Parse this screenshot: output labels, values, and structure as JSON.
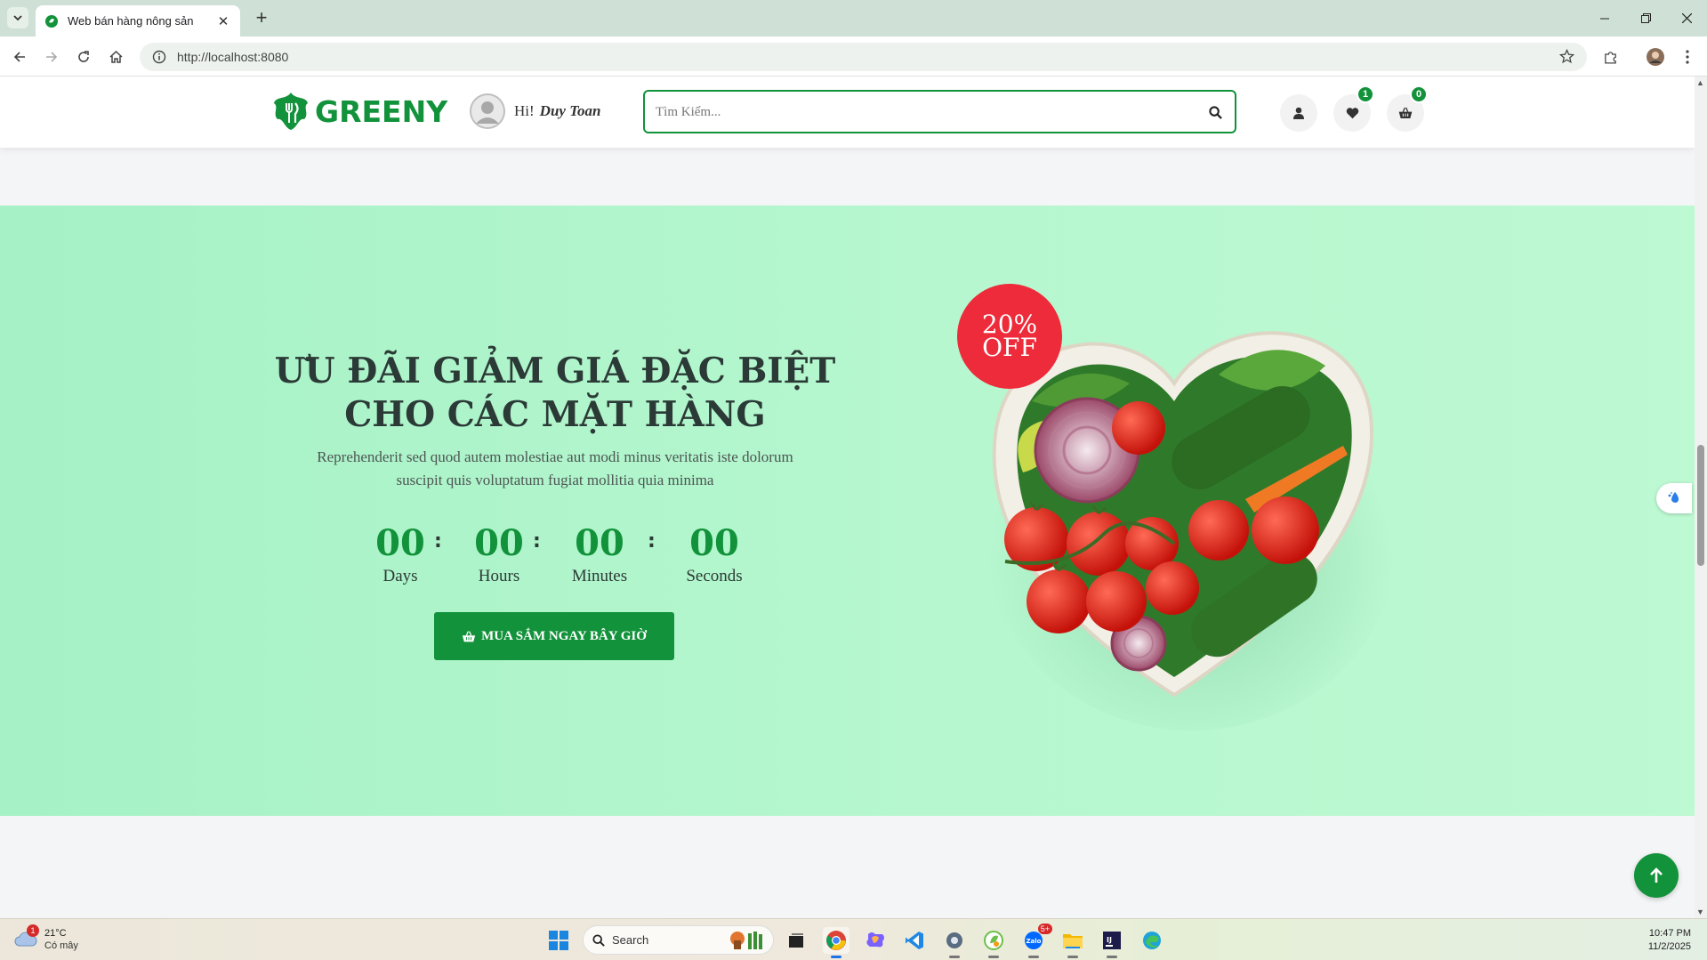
{
  "browser": {
    "tab_title": "Web bán hàng nông sản",
    "url": "http://localhost:8080"
  },
  "header": {
    "logo_text": "GREENY",
    "greeting": "Hi!",
    "user_name": "Duy Toan",
    "search_placeholder": "Tìm Kiếm...",
    "wishlist_count": "1",
    "cart_count": "0"
  },
  "promo": {
    "title_line1": "ƯU ĐÃI GIẢM GIÁ ĐẶC BIỆT",
    "title_line2": "CHO CÁC MẶT HÀNG",
    "description_line1": "Reprehenderit sed quod autem molestiae aut modi minus veritatis iste dolorum",
    "description_line2": "suscipit quis voluptatum fugiat mollitia quia minima",
    "countdown": [
      {
        "value": "00",
        "label": "Days"
      },
      {
        "value": "00",
        "label": "Hours"
      },
      {
        "value": "00",
        "label": "Minutes"
      },
      {
        "value": "00",
        "label": "Seconds"
      }
    ],
    "separator": ":",
    "button_label": "MUA SẮM NGAY BÂY GIỜ",
    "badge_line1": "20%",
    "badge_line2": "OFF"
  },
  "taskbar": {
    "weather_temp": "21°C",
    "weather_condition": "Có mây",
    "weather_badge": "1",
    "search_label": "Search",
    "zalo_badge": "5+",
    "time": "10:47 PM",
    "date": "11/2/2025"
  },
  "colors": {
    "brand_green": "#12923a",
    "promo_bg": "#b6f7cf",
    "badge_red": "#ee2b3a"
  }
}
